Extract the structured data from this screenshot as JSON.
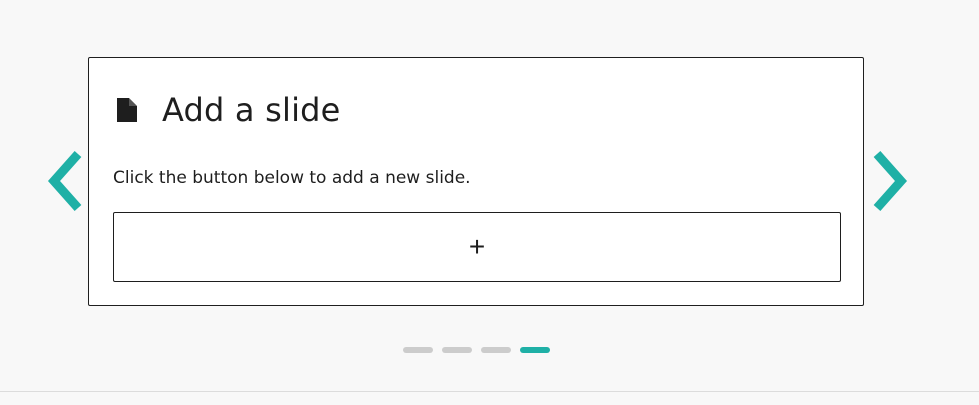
{
  "colors": {
    "accent": "#1fb0a6",
    "page_background": "#f8f8f8",
    "card_border": "#1e1e1e",
    "dot_inactive": "#cccccc"
  },
  "navigation": {
    "prev_icon": "chevron-left-icon",
    "next_icon": "chevron-right-icon"
  },
  "card": {
    "icon": "document-icon",
    "title": "Add a slide",
    "description": "Click the button below to add a new slide.",
    "add_button_label": "+"
  },
  "pagination": {
    "total": 4,
    "active_index": 4
  }
}
